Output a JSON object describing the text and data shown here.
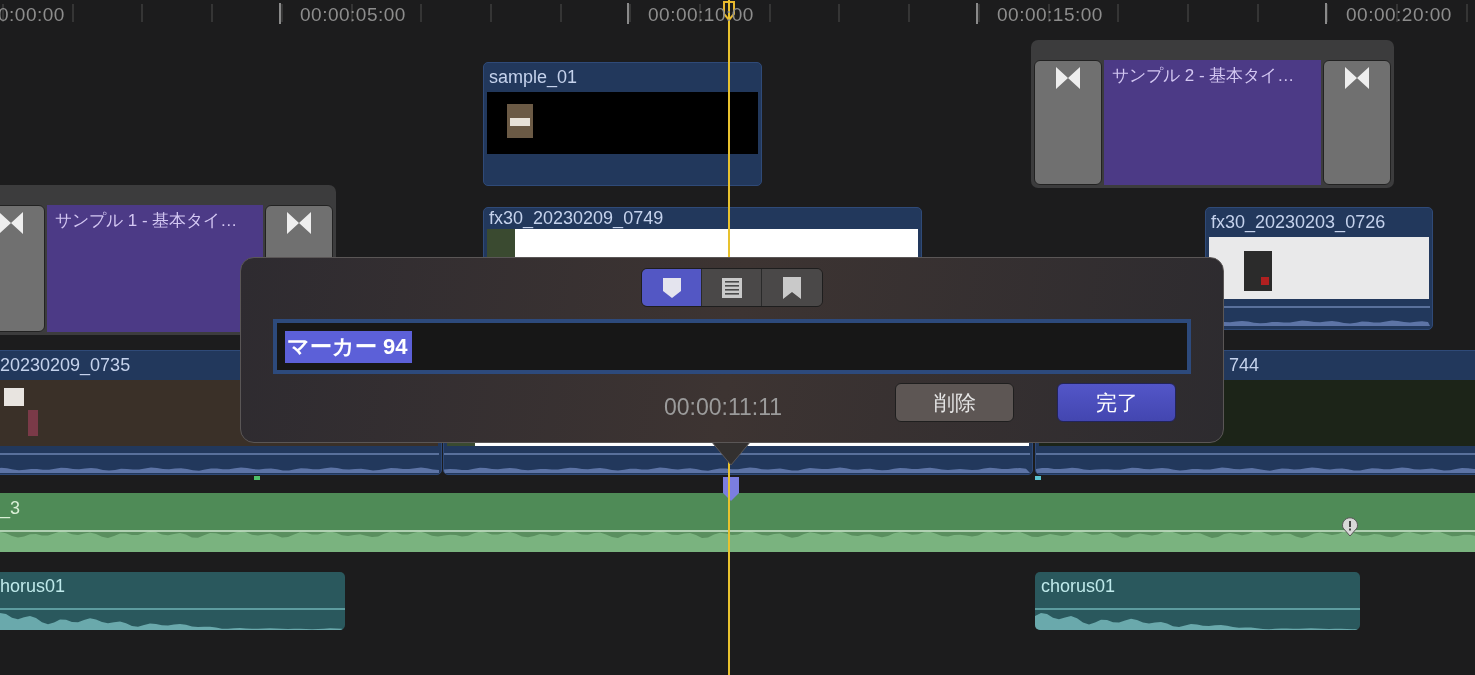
{
  "ruler": {
    "ticks": [
      "0:00:00",
      "00:00:05:00",
      "00:00:10:00",
      "00:00:15:00",
      "00:00:20:00"
    ]
  },
  "clips": [
    {
      "kind": "video",
      "label": "sample_01"
    },
    {
      "kind": "title",
      "label": "サンプル 2 - 基本タイ…"
    },
    {
      "kind": "title",
      "label": "サンプル 1 - 基本タイ…"
    },
    {
      "kind": "video",
      "label": "fx30_20230209_0749"
    },
    {
      "kind": "video",
      "label": "fx30_20230203_0726"
    },
    {
      "kind": "video",
      "label": "20230209_0735"
    },
    {
      "kind": "video"
    },
    {
      "kind": "video",
      "label": "744"
    },
    {
      "kind": "audio",
      "label": "_3"
    },
    {
      "kind": "music",
      "label": "horus01"
    },
    {
      "kind": "music",
      "label": "chorus01"
    }
  ],
  "marker_popover": {
    "tabs": [
      {
        "selected": true
      },
      {
        "selected": false
      },
      {
        "selected": false
      }
    ],
    "name_field": {
      "value": "マーカー 94"
    },
    "timecode": "00:00:11:11",
    "buttons": [
      {
        "label": "削除",
        "kind": "secondary"
      },
      {
        "label": "完了",
        "kind": "primary"
      }
    ]
  }
}
